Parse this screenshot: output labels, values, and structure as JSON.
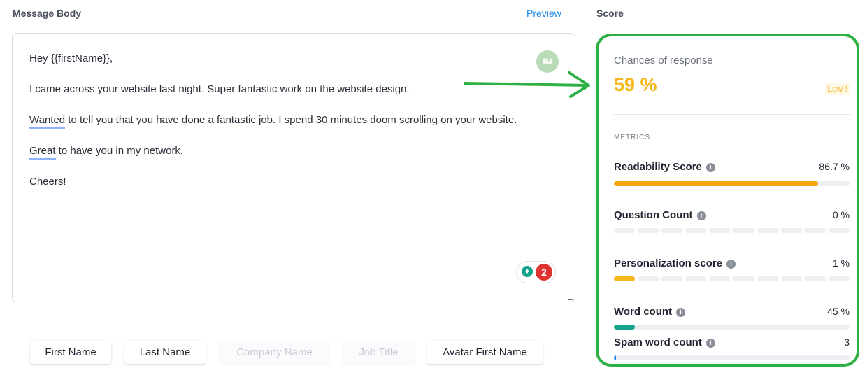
{
  "header": {
    "message_body_label": "Message Body",
    "preview_label": "Preview",
    "score_label": "Score"
  },
  "editor": {
    "lines": [
      "Hey {{firstName}},",
      "I came across your website last night. Super fantastic work on the website design.",
      "Wanted",
      " to tell you that you have done a fantastic job. I spend 30 minutes doom scrolling on your website.",
      "Great",
      " to have you in my network.",
      "Cheers!"
    ],
    "avatar_initials": "IM",
    "assistant_count": "2"
  },
  "variables": [
    {
      "label": "First Name",
      "enabled": true
    },
    {
      "label": "Last Name",
      "enabled": true
    },
    {
      "label": "Company Name",
      "enabled": false
    },
    {
      "label": "Job Title",
      "enabled": false
    },
    {
      "label": "Avatar First Name",
      "enabled": true
    }
  ],
  "score": {
    "chances_label": "Chances of response",
    "chances_value": "59 %",
    "rating_badge": "Low !",
    "metrics_title": "METRICS",
    "metrics": [
      {
        "name": "Readability Score",
        "value": "86.7 %",
        "fraction": 0.867,
        "color": "#f5a70f"
      },
      {
        "name": "Question Count",
        "value": "0 %",
        "fraction": 0.0,
        "color": "#f5b71a"
      },
      {
        "name": "Personalization score",
        "value": "1 %",
        "fraction": 0.1,
        "color": "#f5b71a"
      },
      {
        "name": "Word count",
        "value": "45 %",
        "fraction": 0.09,
        "color": "#14a38b"
      },
      {
        "name": "Spam word count",
        "value": "3",
        "fraction": 0.01,
        "color": "#1a86e8"
      }
    ]
  },
  "colors": {
    "accent_green": "#2fb045",
    "score_orange": "#f5b71a",
    "link_blue": "#1a86e8"
  }
}
